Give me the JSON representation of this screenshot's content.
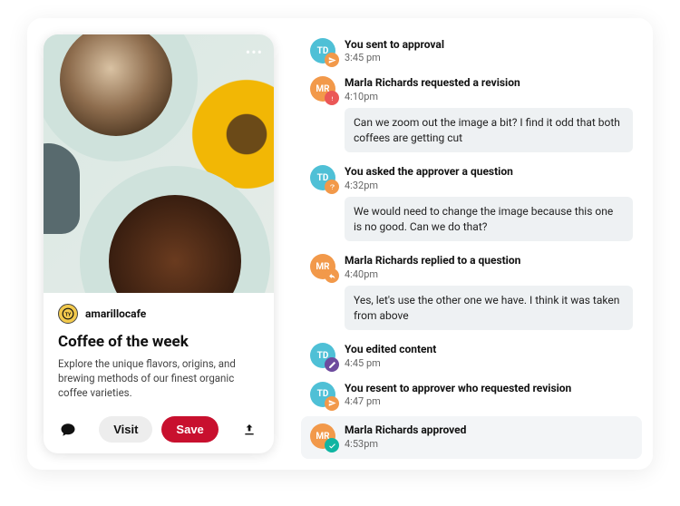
{
  "card": {
    "profile": {
      "avatar_text": "",
      "name": "amarillocafe"
    },
    "title": "Coffee of the week",
    "desc": "Explore the unique flavors, origins, and brewing methods of our finest organic coffee varieties.",
    "visit_label": "Visit",
    "save_label": "Save"
  },
  "activity": [
    {
      "avatar": "TD",
      "avatar_kind": "td",
      "badge": "send",
      "title": "You sent to approval",
      "time": "3:45 pm",
      "msg": null
    },
    {
      "avatar": "MR",
      "avatar_kind": "mr",
      "badge": "alert",
      "title": "Marla Richards requested a revision",
      "time": "4:10pm",
      "msg": "Can we zoom out the image a bit? I find it odd that both coffees are getting cut"
    },
    {
      "avatar": "TD",
      "avatar_kind": "td",
      "badge": "question",
      "title": "You asked the approver a question",
      "time": "4:32pm",
      "msg": "We would need to change the image because this one is no good. Can we do that?"
    },
    {
      "avatar": "MR",
      "avatar_kind": "mr",
      "badge": "reply",
      "title": "Marla Richards replied to a question",
      "time": "4:40pm",
      "msg": "Yes, let's use the other one we have. I think it was taken from above"
    },
    {
      "avatar": "TD",
      "avatar_kind": "td",
      "badge": "edit",
      "title": "You edited content",
      "time": "4:45 pm",
      "msg": null
    },
    {
      "avatar": "TD",
      "avatar_kind": "td",
      "badge": "send",
      "title": "You resent to approver who requested revision",
      "time": "4:47 pm",
      "msg": null
    },
    {
      "avatar": "MR",
      "avatar_kind": "mr",
      "badge": "approve",
      "title": "Marla Richards approved",
      "time": "4:53pm",
      "msg": null,
      "highlight": true
    }
  ]
}
